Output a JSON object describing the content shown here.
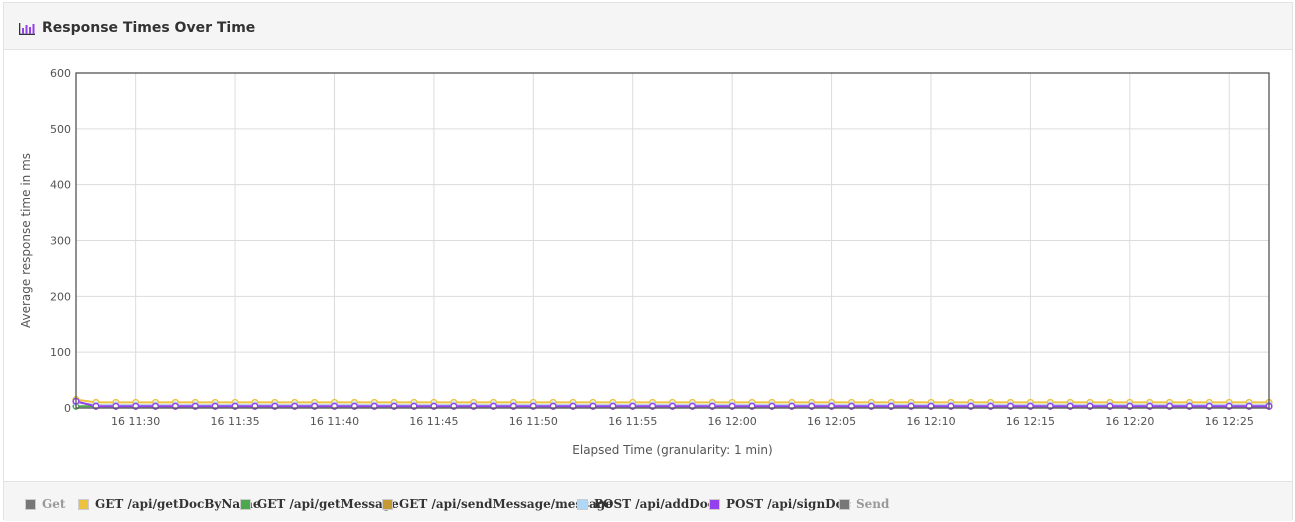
{
  "panel": {
    "title": "Response Times Over Time"
  },
  "chart_data": {
    "type": "line",
    "title": "",
    "xlabel": "Elapsed Time (granularity: 1 min)",
    "ylabel": "Average response time in ms",
    "ylim": [
      0,
      600
    ],
    "yticks": [
      0,
      100,
      200,
      300,
      400,
      500,
      600
    ],
    "x_unit": "minute",
    "xlim": [
      "16 11:27",
      "16 12:27"
    ],
    "xticks": [
      "16 11:30",
      "16 11:35",
      "16 11:40",
      "16 11:45",
      "16 11:50",
      "16 11:55",
      "16 12:00",
      "16 12:05",
      "16 12:10",
      "16 12:15",
      "16 12:20",
      "16 12:25"
    ],
    "grid": true,
    "legend_position": "bottom",
    "x": [
      "16 11:27",
      "16 11:28",
      "16 11:29",
      "16 11:30",
      "16 11:31",
      "16 11:32",
      "16 11:33",
      "16 11:34",
      "16 11:35",
      "16 11:36",
      "16 11:37",
      "16 11:38",
      "16 11:39",
      "16 11:40",
      "16 11:41",
      "16 11:42",
      "16 11:43",
      "16 11:44",
      "16 11:45",
      "16 11:46",
      "16 11:47",
      "16 11:48",
      "16 11:49",
      "16 11:50",
      "16 11:51",
      "16 11:52",
      "16 11:53",
      "16 11:54",
      "16 11:55",
      "16 11:56",
      "16 11:57",
      "16 11:58",
      "16 11:59",
      "16 12:00",
      "16 12:01",
      "16 12:02",
      "16 12:03",
      "16 12:04",
      "16 12:05",
      "16 12:06",
      "16 12:07",
      "16 12:08",
      "16 12:09",
      "16 12:10",
      "16 12:11",
      "16 12:12",
      "16 12:13",
      "16 12:14",
      "16 12:15",
      "16 12:16",
      "16 12:17",
      "16 12:18",
      "16 12:19",
      "16 12:20",
      "16 12:21",
      "16 12:22",
      "16 12:23",
      "16 12:24",
      "16 12:25",
      "16 12:26",
      "16 12:27"
    ],
    "series": [
      {
        "name": "Get",
        "color": "#777777",
        "visible": false,
        "values": []
      },
      {
        "name": "GET /api/getDocByName",
        "color": "#edc240",
        "visible": true,
        "values": [
          15,
          10,
          10,
          10,
          10,
          10,
          10,
          10,
          10,
          10,
          10,
          10,
          10,
          10,
          10,
          10,
          10,
          10,
          10,
          10,
          10,
          10,
          10,
          10,
          10,
          10,
          10,
          10,
          10,
          10,
          10,
          10,
          10,
          10,
          10,
          10,
          10,
          10,
          10,
          10,
          10,
          10,
          10,
          10,
          10,
          10,
          10,
          10,
          10,
          10,
          10,
          10,
          10,
          10,
          10,
          10,
          10,
          10,
          10,
          10,
          10
        ]
      },
      {
        "name": "GET /api/getMessage",
        "color": "#4da74d",
        "visible": true,
        "values": [
          3,
          3,
          3,
          3,
          3,
          3,
          3,
          3,
          3,
          3,
          3,
          3,
          3,
          3,
          3,
          3,
          3,
          3,
          3,
          3,
          3,
          3,
          3,
          3,
          3,
          3,
          3,
          3,
          3,
          3,
          3,
          3,
          3,
          3,
          3,
          3,
          3,
          3,
          3,
          3,
          3,
          3,
          3,
          3,
          3,
          3,
          3,
          3,
          3,
          3,
          3,
          3,
          3,
          3,
          3,
          3,
          3,
          3,
          3,
          3,
          3
        ]
      },
      {
        "name": "GET /api/sendMessage/message",
        "color": "#c49a35",
        "visible": true,
        "values": [
          10,
          5,
          5,
          5,
          5,
          5,
          5,
          5,
          5,
          5,
          5,
          5,
          5,
          5,
          5,
          5,
          5,
          5,
          5,
          5,
          5,
          5,
          5,
          5,
          5,
          5,
          5,
          5,
          5,
          5,
          5,
          5,
          5,
          5,
          5,
          5,
          5,
          5,
          5,
          5,
          5,
          5,
          5,
          5,
          5,
          5,
          5,
          5,
          5,
          5,
          5,
          5,
          5,
          5,
          5,
          5,
          5,
          5,
          5,
          5,
          5
        ]
      },
      {
        "name": "POST /api/addDoc",
        "color": "#afd8f8",
        "visible": true,
        "values": [
          10,
          5,
          5,
          5,
          5,
          5,
          5,
          5,
          5,
          5,
          5,
          5,
          5,
          5,
          5,
          5,
          5,
          5,
          5,
          5,
          5,
          5,
          5,
          5,
          5,
          5,
          5,
          5,
          5,
          5,
          5,
          5,
          5,
          5,
          5,
          5,
          5,
          5,
          5,
          5,
          5,
          5,
          5,
          5,
          5,
          5,
          5,
          5,
          5,
          5,
          5,
          5,
          5,
          5,
          5,
          5,
          5,
          5,
          5,
          5,
          5
        ]
      },
      {
        "name": "POST /api/signDoc",
        "color": "#9440ed",
        "visible": true,
        "values": [
          12,
          3,
          3,
          3,
          3,
          3,
          3,
          3,
          3,
          3,
          3,
          3,
          3,
          3,
          3,
          3,
          3,
          3,
          3,
          3,
          3,
          3,
          3,
          3,
          3,
          3,
          3,
          3,
          3,
          3,
          3,
          3,
          3,
          3,
          3,
          3,
          3,
          3,
          3,
          3,
          3,
          3,
          3,
          3,
          3,
          3,
          3,
          3,
          3,
          3,
          3,
          3,
          3,
          3,
          3,
          3,
          3,
          3,
          3,
          3,
          3
        ]
      },
      {
        "name": "Send",
        "color": "#777777",
        "visible": false,
        "values": []
      }
    ]
  }
}
